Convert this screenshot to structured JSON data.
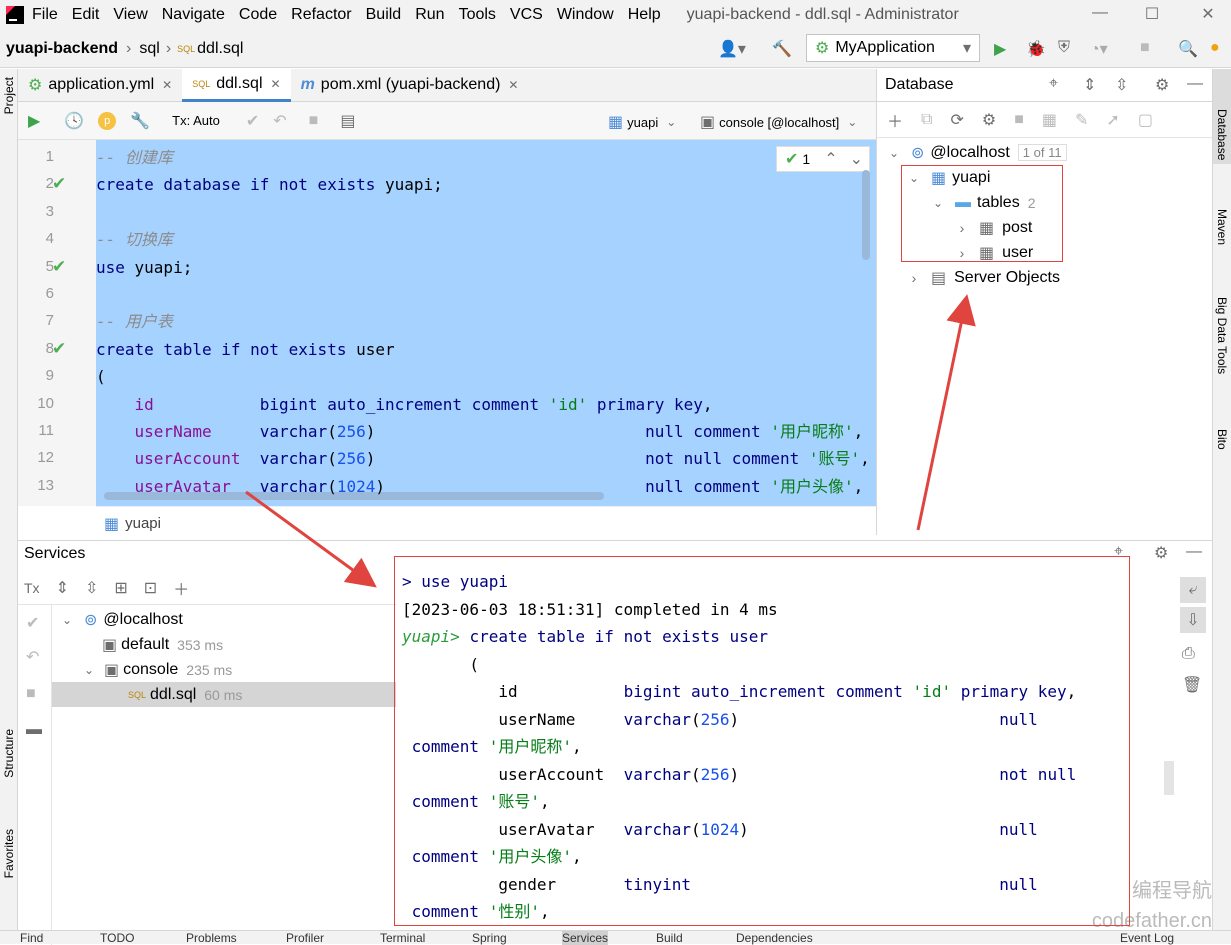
{
  "window": {
    "title": "yuapi-backend - ddl.sql - Administrator",
    "menu": [
      "File",
      "Edit",
      "View",
      "Navigate",
      "Code",
      "Refactor",
      "Build",
      "Run",
      "Tools",
      "VCS",
      "Window",
      "Help"
    ]
  },
  "breadcrumb": {
    "project": "yuapi-backend",
    "folder": "sql",
    "file": "ddl.sql"
  },
  "run_config": "MyApplication",
  "editor_tabs": [
    {
      "label": "application.yml",
      "active": false
    },
    {
      "label": "ddl.sql",
      "active": true
    },
    {
      "label": "pom.xml (yuapi-backend)",
      "active": false
    }
  ],
  "editor_toolbar": {
    "tx": "Tx: Auto",
    "schema": "yuapi",
    "console": "console [@localhost]"
  },
  "inspection": {
    "count": "1"
  },
  "code": [
    {
      "n": "1",
      "check": false,
      "parts": [
        {
          "c": "cm",
          "t": "-- 创建库"
        }
      ]
    },
    {
      "n": "2",
      "check": true,
      "parts": [
        {
          "c": "kw",
          "t": "create database if not exists "
        },
        {
          "c": "",
          "t": "yuapi;"
        }
      ]
    },
    {
      "n": "3",
      "check": false,
      "parts": []
    },
    {
      "n": "4",
      "check": false,
      "parts": [
        {
          "c": "cm",
          "t": "-- 切换库"
        }
      ]
    },
    {
      "n": "5",
      "check": true,
      "parts": [
        {
          "c": "kw",
          "t": "use "
        },
        {
          "c": "",
          "t": "yuapi;"
        }
      ]
    },
    {
      "n": "6",
      "check": false,
      "parts": []
    },
    {
      "n": "7",
      "check": false,
      "parts": [
        {
          "c": "cm",
          "t": "-- 用户表"
        }
      ]
    },
    {
      "n": "8",
      "check": true,
      "parts": [
        {
          "c": "kw",
          "t": "create table if not exists "
        },
        {
          "c": "",
          "t": "user"
        }
      ]
    },
    {
      "n": "9",
      "check": false,
      "parts": [
        {
          "c": "",
          "t": "("
        }
      ]
    },
    {
      "n": "10",
      "check": false,
      "parts": [
        {
          "c": "col",
          "t": "    id"
        },
        {
          "c": "kw",
          "t": "           bigint auto_increment comment "
        },
        {
          "c": "str",
          "t": "'id'"
        },
        {
          "c": "kw",
          "t": " primary key"
        },
        {
          "c": "",
          "t": ","
        }
      ]
    },
    {
      "n": "11",
      "check": false,
      "parts": [
        {
          "c": "col",
          "t": "    userName"
        },
        {
          "c": "kw",
          "t": "     varchar"
        },
        {
          "c": "",
          "t": "("
        },
        {
          "c": "num",
          "t": "256"
        },
        {
          "c": "",
          "t": ")"
        },
        {
          "c": "kw",
          "t": "                            null comment "
        },
        {
          "c": "str",
          "t": "'用户昵称'"
        },
        {
          "c": "",
          "t": ","
        }
      ]
    },
    {
      "n": "12",
      "check": false,
      "parts": [
        {
          "c": "col",
          "t": "    userAccount"
        },
        {
          "c": "kw",
          "t": "  varchar"
        },
        {
          "c": "",
          "t": "("
        },
        {
          "c": "num",
          "t": "256"
        },
        {
          "c": "",
          "t": ")"
        },
        {
          "c": "kw",
          "t": "                            not null comment "
        },
        {
          "c": "str",
          "t": "'账号'"
        },
        {
          "c": "",
          "t": ","
        }
      ]
    },
    {
      "n": "13",
      "check": false,
      "parts": [
        {
          "c": "col",
          "t": "    userAvatar"
        },
        {
          "c": "kw",
          "t": "   varchar"
        },
        {
          "c": "",
          "t": "("
        },
        {
          "c": "num",
          "t": "1024"
        },
        {
          "c": "",
          "t": ")"
        },
        {
          "c": "kw",
          "t": "                           null comment "
        },
        {
          "c": "str",
          "t": "'用户头像'"
        },
        {
          "c": "",
          "t": ","
        }
      ]
    }
  ],
  "editor_footer": "yuapi",
  "database": {
    "title": "Database",
    "host": "@localhost",
    "host_badge": "1 of 11",
    "schema": "yuapi",
    "tables_label": "tables",
    "tables_count": "2",
    "tables": [
      "post",
      "user"
    ],
    "server_objects": "Server Objects"
  },
  "services": {
    "title": "Services",
    "tree": [
      {
        "label": "@localhost",
        "time": ""
      },
      {
        "label": "default",
        "time": "353 ms"
      },
      {
        "label": "console",
        "time": "235 ms"
      },
      {
        "label": "ddl.sql",
        "time": "60 ms"
      }
    ],
    "output": [
      {
        "indent": 0,
        "parts": [
          {
            "c": "kw",
            "t": "> use yuapi"
          }
        ]
      },
      {
        "indent": 0,
        "parts": [
          {
            "c": "",
            "t": "[2023-06-03 18:51:31] completed in 4 ms"
          }
        ]
      },
      {
        "indent": 0,
        "parts": [
          {
            "c": "prompt",
            "t": "yuapi> "
          },
          {
            "c": "kw",
            "t": "create table if not exists user"
          }
        ]
      },
      {
        "indent": 0,
        "parts": [
          {
            "c": "",
            "t": "       ("
          }
        ]
      },
      {
        "indent": 0,
        "parts": [
          {
            "c": "",
            "t": "          id           "
          },
          {
            "c": "kw",
            "t": "bigint auto_increment comment "
          },
          {
            "c": "str",
            "t": "'id'"
          },
          {
            "c": "kw",
            "t": " primary key"
          },
          {
            "c": "",
            "t": ","
          }
        ]
      },
      {
        "indent": 0,
        "parts": [
          {
            "c": "",
            "t": "          userName     "
          },
          {
            "c": "kw",
            "t": "varchar"
          },
          {
            "c": "",
            "t": "("
          },
          {
            "c": "num",
            "t": "256"
          },
          {
            "c": "",
            "t": ")"
          },
          {
            "c": "kw",
            "t": "                           null"
          }
        ]
      },
      {
        "indent": 0,
        "parts": [
          {
            "c": "kw",
            "t": " comment "
          },
          {
            "c": "str",
            "t": "'用户昵称'"
          },
          {
            "c": "",
            "t": ","
          }
        ]
      },
      {
        "indent": 0,
        "parts": [
          {
            "c": "",
            "t": "          userAccount  "
          },
          {
            "c": "kw",
            "t": "varchar"
          },
          {
            "c": "",
            "t": "("
          },
          {
            "c": "num",
            "t": "256"
          },
          {
            "c": "",
            "t": ")"
          },
          {
            "c": "kw",
            "t": "                           not null"
          }
        ]
      },
      {
        "indent": 0,
        "parts": [
          {
            "c": "kw",
            "t": " comment "
          },
          {
            "c": "str",
            "t": "'账号'"
          },
          {
            "c": "",
            "t": ","
          }
        ]
      },
      {
        "indent": 0,
        "parts": [
          {
            "c": "",
            "t": "          userAvatar   "
          },
          {
            "c": "kw",
            "t": "varchar"
          },
          {
            "c": "",
            "t": "("
          },
          {
            "c": "num",
            "t": "1024"
          },
          {
            "c": "",
            "t": ")"
          },
          {
            "c": "kw",
            "t": "                          null"
          }
        ]
      },
      {
        "indent": 0,
        "parts": [
          {
            "c": "kw",
            "t": " comment "
          },
          {
            "c": "str",
            "t": "'用户头像'"
          },
          {
            "c": "",
            "t": ","
          }
        ]
      },
      {
        "indent": 0,
        "parts": [
          {
            "c": "",
            "t": "          gender       "
          },
          {
            "c": "kw",
            "t": "tinyint"
          },
          {
            "c": "kw",
            "t": "                                null"
          }
        ]
      },
      {
        "indent": 0,
        "parts": [
          {
            "c": "kw",
            "t": " comment "
          },
          {
            "c": "str",
            "t": "'性别'"
          },
          {
            "c": "",
            "t": ","
          }
        ]
      }
    ]
  },
  "left_strip": [
    "Project",
    "Structure",
    "Favorites"
  ],
  "right_strip": [
    "Database",
    "Maven",
    "Big Data Tools",
    "Bito"
  ],
  "status_tabs": [
    "Find",
    "TODO",
    "Problems",
    "Profiler",
    "Terminal",
    "Spring",
    "Services",
    "Build",
    "Dependencies",
    "Event Log"
  ],
  "watermark": [
    "编程导航",
    "codefather.cn"
  ],
  "colors": {
    "selection": "#a6d2ff",
    "accent": "#4083c9",
    "annotation": "#e0443e",
    "check": "#4caf50"
  }
}
